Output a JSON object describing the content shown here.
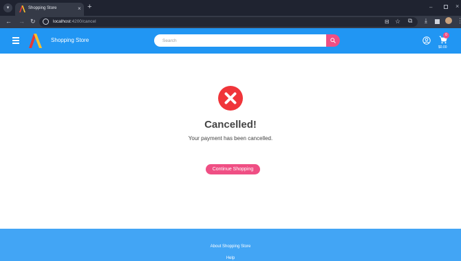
{
  "browser": {
    "tab_title": "Shopping Store",
    "tab_close": "×",
    "new_tab": "+",
    "url_host": "localhost",
    "url_path": ":4200/cancel",
    "window_controls": {
      "minimize": "–",
      "close": "×"
    },
    "icons": [
      "tab-search-icon",
      "back-arrow-icon",
      "forward-arrow-icon",
      "reload-icon",
      "site-info-icon",
      "install-icon",
      "star-icon",
      "extensions-icon",
      "download-icon",
      "side-panel-icon",
      "profile-icon",
      "menu-dots-icon"
    ]
  },
  "header": {
    "brand": "Shopping Store",
    "search_placeholder": "Search",
    "cart_count": "0",
    "cart_total": "$0.00",
    "colors": {
      "header": "#2196f3",
      "accent": "#ef4f84"
    },
    "icons": [
      "menu-icon",
      "logo-icon",
      "search-icon",
      "account-icon",
      "cart-icon"
    ]
  },
  "main": {
    "heading": "Cancelled!",
    "message": "Your payment has been cancelled.",
    "button_label": "Continue Shopping",
    "colors": {
      "status": "#f0353a"
    },
    "icons": [
      "cancel-x-icon"
    ]
  },
  "footer": {
    "links": [
      "About Shopping Store",
      "Help"
    ],
    "colors": {
      "background": "#42a5f5"
    }
  }
}
